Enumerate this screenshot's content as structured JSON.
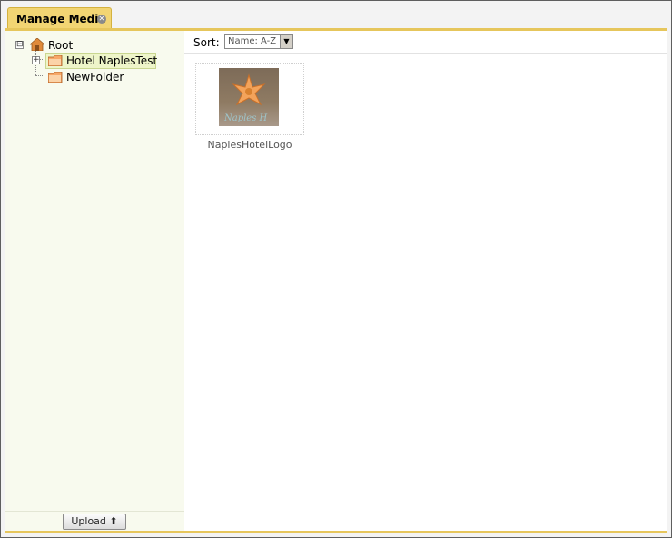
{
  "tab": {
    "label": "Manage Media"
  },
  "tree": {
    "root": {
      "label": "Root",
      "expander": "⊟"
    },
    "items": [
      {
        "label": "Hotel NaplesTest",
        "expander": "+"
      },
      {
        "label": "NewFolder"
      }
    ]
  },
  "sort": {
    "label": "Sort:",
    "value": "Name: A-Z"
  },
  "media": [
    {
      "name": "NaplesHotelLogo",
      "thumb_text": "Naples H"
    }
  ],
  "upload": {
    "label": "Upload"
  },
  "colors": {
    "tab": "#f2d573",
    "accent_border": "#e6c65c",
    "sidebar": "#f8faee"
  }
}
